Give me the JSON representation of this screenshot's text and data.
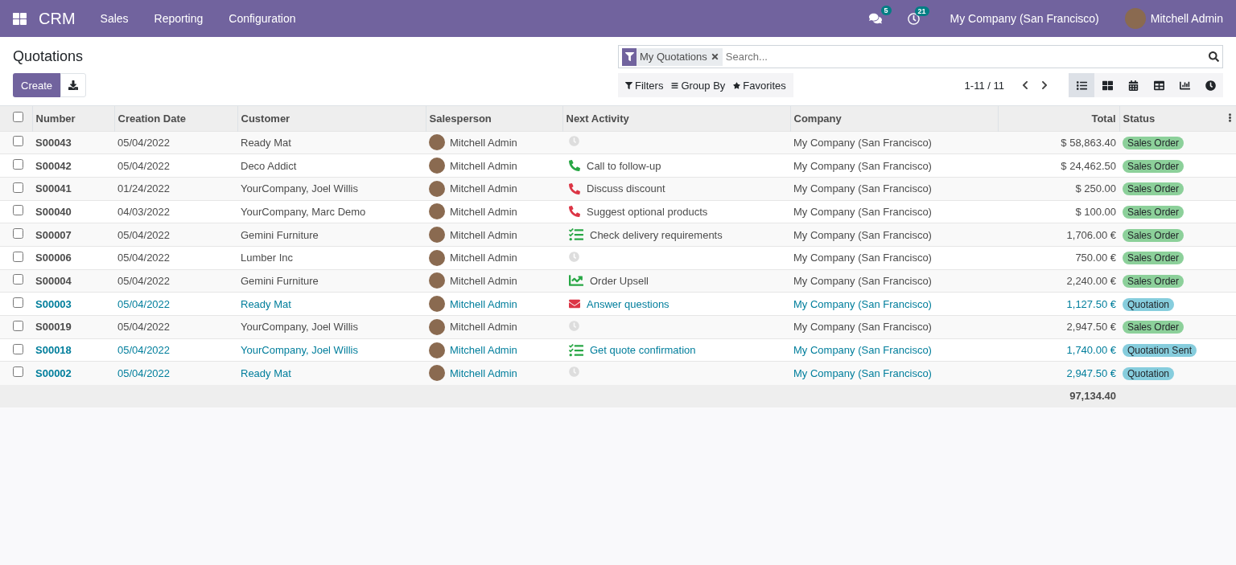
{
  "navbar": {
    "app": "CRM",
    "menus": [
      "Sales",
      "Reporting",
      "Configuration"
    ],
    "messages_badge": "5",
    "activities_badge": "21",
    "company": "My Company (San Francisco)",
    "user": "Mitchell Admin"
  },
  "page": {
    "title": "Quotations",
    "create": "Create"
  },
  "search": {
    "facet": "My Quotations",
    "placeholder": "Search...",
    "filters": "Filters",
    "group_by": "Group By",
    "favorites": "Favorites"
  },
  "pager": "1-11 / 11",
  "views": [
    {
      "kind": "list",
      "selected": true
    },
    {
      "kind": "kanban",
      "selected": false
    },
    {
      "kind": "calendar",
      "selected": false
    },
    {
      "kind": "pivot",
      "selected": false
    },
    {
      "kind": "graph",
      "selected": false
    },
    {
      "kind": "activity",
      "selected": false
    }
  ],
  "table": {
    "all_checked": false,
    "columns": [
      "Number",
      "Creation Date",
      "Customer",
      "Salesperson",
      "Next Activity",
      "Company",
      "Total",
      "Status"
    ],
    "rows": [
      {
        "number": "S00043",
        "date": "05/04/2022",
        "customer": "Ready Mat",
        "salesperson": "Mitchell Admin",
        "activity": {
          "kind": "none"
        },
        "company": "My Company (San Francisco)",
        "total": "$ 58,863.40",
        "status": {
          "label": "Sales Order",
          "kind": "sale"
        },
        "checked": false
      },
      {
        "number": "S00042",
        "date": "05/04/2022",
        "customer": "Deco Addict",
        "salesperson": "Mitchell Admin",
        "activity": {
          "kind": "call",
          "label": "Call to follow-up",
          "color": "#28a745"
        },
        "company": "My Company (San Francisco)",
        "total": "$ 24,462.50",
        "status": {
          "label": "Sales Order",
          "kind": "sale"
        },
        "checked": false
      },
      {
        "number": "S00041",
        "date": "01/24/2022",
        "customer": "YourCompany, Joel Willis",
        "salesperson": "Mitchell Admin",
        "activity": {
          "kind": "call",
          "label": "Discuss discount",
          "color": "#dc3545"
        },
        "company": "My Company (San Francisco)",
        "total": "$ 250.00",
        "status": {
          "label": "Sales Order",
          "kind": "sale"
        },
        "checked": false
      },
      {
        "number": "S00040",
        "date": "04/03/2022",
        "customer": "YourCompany, Marc Demo",
        "salesperson": "Mitchell Admin",
        "activity": {
          "kind": "call",
          "label": "Suggest optional products",
          "color": "#dc3545"
        },
        "company": "My Company (San Francisco)",
        "total": "$ 100.00",
        "status": {
          "label": "Sales Order",
          "kind": "sale"
        },
        "checked": false
      },
      {
        "number": "S00007",
        "date": "05/04/2022",
        "customer": "Gemini Furniture",
        "salesperson": "Mitchell Admin",
        "activity": {
          "kind": "task",
          "label": "Check delivery requirements",
          "color": "#28a745"
        },
        "company": "My Company (San Francisco)",
        "total": "1,706.00 €",
        "status": {
          "label": "Sales Order",
          "kind": "sale"
        },
        "checked": false
      },
      {
        "number": "S00006",
        "date": "05/04/2022",
        "customer": "Lumber Inc",
        "salesperson": "Mitchell Admin",
        "activity": {
          "kind": "none"
        },
        "company": "My Company (San Francisco)",
        "total": "750.00 €",
        "status": {
          "label": "Sales Order",
          "kind": "sale"
        },
        "checked": false
      },
      {
        "number": "S00004",
        "date": "05/04/2022",
        "customer": "Gemini Furniture",
        "salesperson": "Mitchell Admin",
        "activity": {
          "kind": "upsell",
          "label": "Order Upsell",
          "color": "#28a745"
        },
        "company": "My Company (San Francisco)",
        "total": "2,240.00 €",
        "status": {
          "label": "Sales Order",
          "kind": "sale"
        },
        "checked": false
      },
      {
        "number": "S00003",
        "date": "05/04/2022",
        "customer": "Ready Mat",
        "salesperson": "Mitchell Admin",
        "activity": {
          "kind": "email",
          "label": "Answer questions",
          "color": "#dc3545"
        },
        "company": "My Company (San Francisco)",
        "total": "1,127.50 €",
        "status": {
          "label": "Quotation",
          "kind": "draft"
        },
        "checked": false
      },
      {
        "number": "S00019",
        "date": "05/04/2022",
        "customer": "YourCompany, Joel Willis",
        "salesperson": "Mitchell Admin",
        "activity": {
          "kind": "none"
        },
        "company": "My Company (San Francisco)",
        "total": "2,947.50 €",
        "status": {
          "label": "Sales Order",
          "kind": "sale"
        },
        "checked": false
      },
      {
        "number": "S00018",
        "date": "05/04/2022",
        "customer": "YourCompany, Joel Willis",
        "salesperson": "Mitchell Admin",
        "activity": {
          "kind": "task",
          "label": "Get quote confirmation",
          "color": "#28a745"
        },
        "company": "My Company (San Francisco)",
        "total": "1,740.00 €",
        "status": {
          "label": "Quotation Sent",
          "kind": "sent"
        },
        "checked": false
      },
      {
        "number": "S00002",
        "date": "05/04/2022",
        "customer": "Ready Mat",
        "salesperson": "Mitchell Admin",
        "activity": {
          "kind": "none"
        },
        "company": "My Company (San Francisco)",
        "total": "2,947.50 €",
        "status": {
          "label": "Quotation",
          "kind": "draft"
        },
        "checked": false
      }
    ],
    "sum_total": "97,134.40"
  }
}
